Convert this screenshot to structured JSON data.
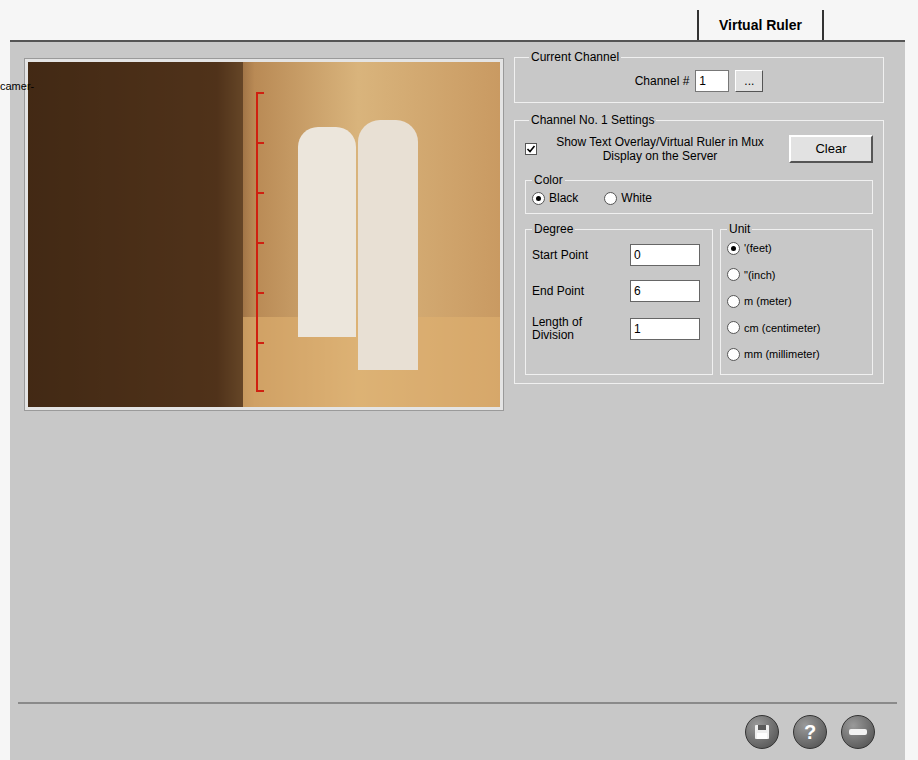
{
  "stray_text": "camer-",
  "tabs": [
    {
      "label": "Virtual Ruler",
      "selected": true
    }
  ],
  "current_channel": {
    "title": "Current Channel",
    "label": "Channel #",
    "value": "1",
    "browse_button": "..."
  },
  "settings": {
    "title": "Channel No. 1 Settings",
    "show_overlay": {
      "label": "Show Text Overlay/Virtual Ruler in Mux Display on the Server",
      "checked": true
    },
    "clear_button": "Clear",
    "color": {
      "title": "Color",
      "options": [
        {
          "label": "Black",
          "selected": true
        },
        {
          "label": "White",
          "selected": false
        }
      ]
    },
    "degree": {
      "title": "Degree",
      "fields": [
        {
          "label": "Start Point",
          "value": "0"
        },
        {
          "label": "End Point",
          "value": "6"
        },
        {
          "label": "Length of Division",
          "value": "1"
        }
      ]
    },
    "unit": {
      "title": "Unit",
      "options": [
        {
          "label": "'(feet)",
          "selected": true
        },
        {
          "label": "\"(inch)",
          "selected": false
        },
        {
          "label": "m (meter)",
          "selected": false
        },
        {
          "label": "cm (centimeter)",
          "selected": false
        },
        {
          "label": "mm (millimeter)",
          "selected": false
        }
      ]
    }
  },
  "toolbar": {
    "help_glyph": "?"
  }
}
